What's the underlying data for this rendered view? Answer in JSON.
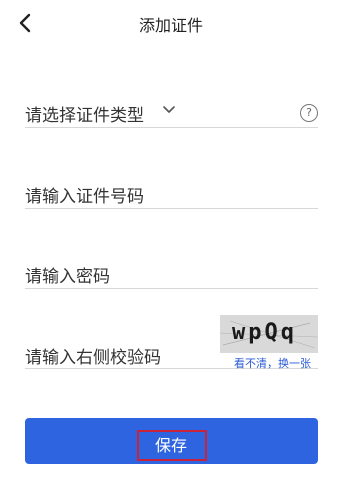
{
  "header": {
    "title": "添加证件",
    "back_icon": "chevron-left-icon"
  },
  "form": {
    "cert_type": {
      "placeholder": "请选择证件类型",
      "dropdown_icon": "chevron-down-icon",
      "help_icon": "question-circle-icon",
      "help_glyph": "?"
    },
    "cert_number": {
      "placeholder": "请输入证件号码"
    },
    "password": {
      "placeholder": "请输入密码"
    },
    "captcha": {
      "placeholder": "请输入右侧校验码",
      "image_text": "wpQq",
      "refresh_link": "看不清，换一张"
    }
  },
  "actions": {
    "save_label": "保存"
  },
  "colors": {
    "primary": "#2f64e0",
    "highlight_border": "#c8233a",
    "link": "#2a5bd7",
    "captcha_bg": "#d9d9d9"
  }
}
